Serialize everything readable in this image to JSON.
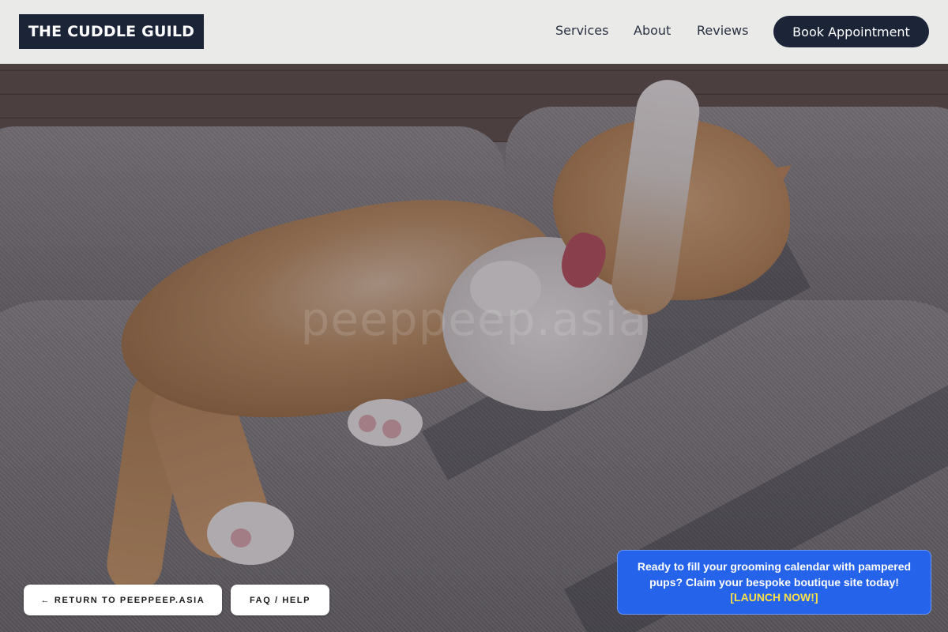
{
  "header": {
    "logo": "THE CUDDLE GUILD",
    "nav": [
      {
        "label": "Services"
      },
      {
        "label": "About"
      },
      {
        "label": "Reviews"
      }
    ],
    "cta_label": "Book Appointment"
  },
  "hero": {
    "watermark": "peeppeep.asia"
  },
  "footer_actions": {
    "return_label": "← RETURN TO PEEPPEEP.ASIA",
    "faq_label": "FAQ / HELP"
  },
  "promo": {
    "text": "Ready to fill your grooming calendar with pampered pups? Claim your bespoke boutique site today!",
    "cta": "[LAUNCH NOW!]"
  },
  "colors": {
    "brand_navy": "#1c2438",
    "promo_blue": "#2563eb",
    "cta_yellow": "#fde047",
    "header_bg": "#f0efee"
  }
}
